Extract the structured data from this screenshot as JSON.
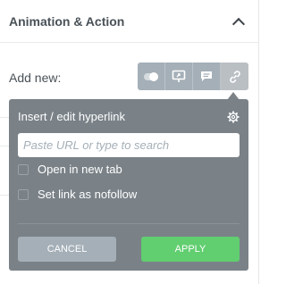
{
  "section": {
    "title": "Animation & Action"
  },
  "add_new": {
    "label": "Add new:"
  },
  "toolbar": {
    "buttons": [
      {
        "icon": "toggle-icon"
      },
      {
        "icon": "popup-icon"
      },
      {
        "icon": "comment-icon"
      },
      {
        "icon": "link-icon"
      }
    ]
  },
  "link_popover": {
    "title": "Insert / edit hyperlink",
    "url_placeholder": "Paste URL or type to search",
    "url_value": "",
    "options": [
      {
        "label": "Open in new tab",
        "checked": false
      },
      {
        "label": "Set link as nofollow",
        "checked": false
      }
    ],
    "cancel_label": "CANCEL",
    "apply_label": "APPLY"
  },
  "colors": {
    "popover_bg": "#7a8288",
    "toolbar_btn": "#a4afb7",
    "apply_btn": "#61ce70",
    "cancel_btn": "#a4afb7"
  }
}
